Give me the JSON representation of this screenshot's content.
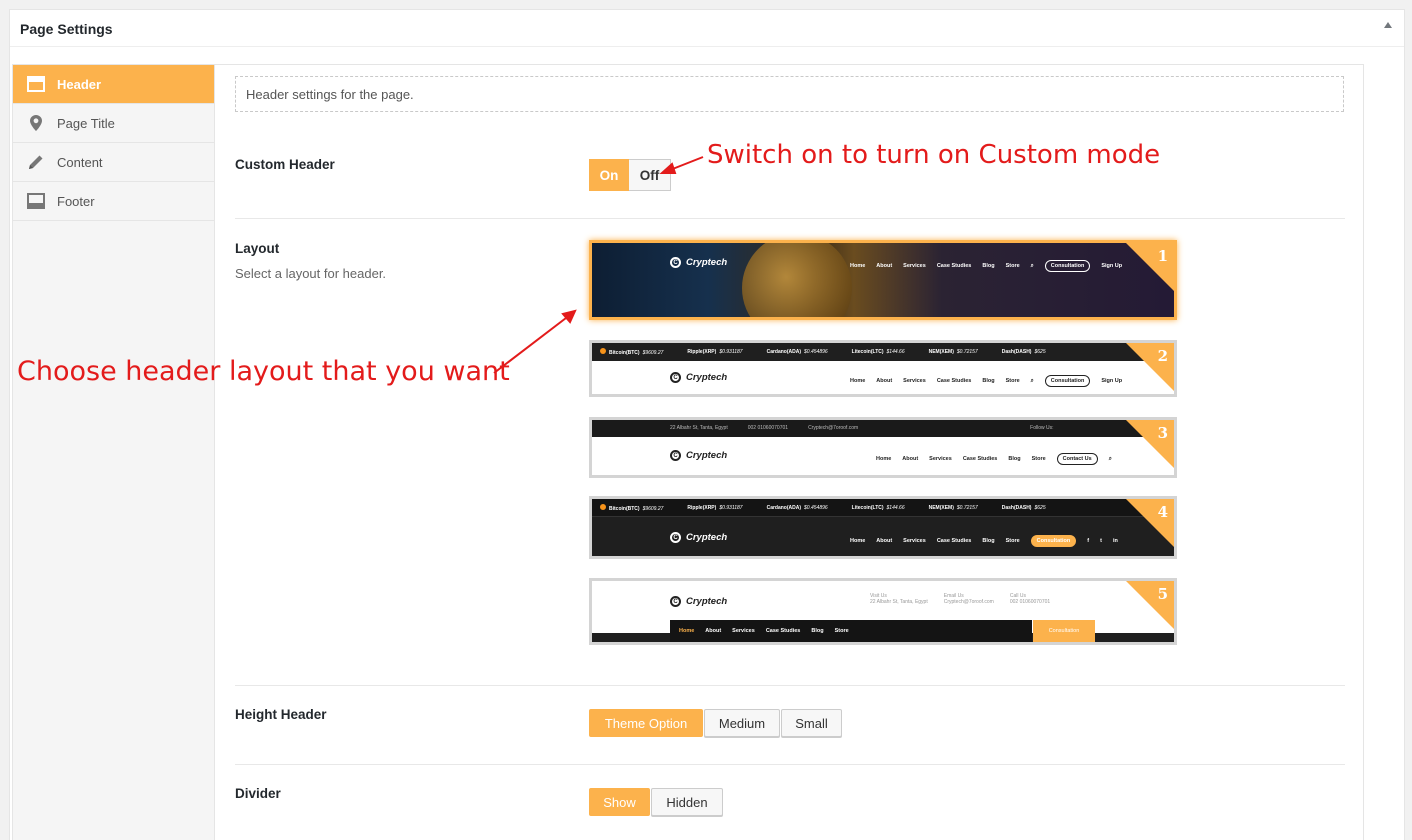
{
  "metabox": {
    "title": "Page Settings"
  },
  "sidebar": {
    "items": [
      {
        "label": "Header",
        "icon": "header-layout-icon",
        "active": true
      },
      {
        "label": "Page Title",
        "icon": "location-pin-icon",
        "active": false
      },
      {
        "label": "Content",
        "icon": "pencil-icon",
        "active": false
      },
      {
        "label": "Footer",
        "icon": "footer-layout-icon",
        "active": false
      }
    ]
  },
  "main": {
    "description": "Header settings for the page.",
    "custom_header": {
      "label": "Custom Header",
      "on": "On",
      "off": "Off",
      "value": "On"
    },
    "layout": {
      "label": "Layout",
      "sub": "Select a layout for header.",
      "selected": 1,
      "options": [
        {
          "number": "1",
          "logo": "Cryptech",
          "nav": [
            "Home",
            "About",
            "Services",
            "Case Studies",
            "Blog",
            "Store"
          ],
          "cta": "Consultation",
          "extra": "Sign Up"
        },
        {
          "number": "2",
          "logo": "Cryptech",
          "nav": [
            "Home",
            "About",
            "Services",
            "Case Studies",
            "Blog",
            "Store"
          ],
          "cta": "Consultation",
          "extra": "Sign Up",
          "ticker": [
            [
              "Bitcoin(BTC)",
              "$9609.27"
            ],
            [
              "Ripple(XRP)",
              "$0.931187"
            ],
            [
              "Cardano(ADA)",
              "$0.454896"
            ],
            [
              "Litecoin(LTC)",
              "$144.66"
            ],
            [
              "NEM(XEM)",
              "$0.72157"
            ],
            [
              "Dash(DASH)",
              "$625"
            ]
          ]
        },
        {
          "number": "3",
          "logo": "Cryptech",
          "nav": [
            "Home",
            "About",
            "Services",
            "Case Studies",
            "Blog",
            "Store"
          ],
          "cta": "Contact Us",
          "topbar": [
            "22 Albahr St, Tanta, Egypt",
            "002 01060070701",
            "Cryptech@7oroof.com"
          ],
          "follow": "Follow Us:"
        },
        {
          "number": "4",
          "logo": "Cryptech",
          "nav": [
            "Home",
            "About",
            "Services",
            "Case Studies",
            "Blog",
            "Store"
          ],
          "cta": "Consultation",
          "ticker": [
            [
              "Bitcoin(BTC)",
              "$9609.27"
            ],
            [
              "Ripple(XRP)",
              "$0.931187"
            ],
            [
              "Cardano(ADA)",
              "$0.454896"
            ],
            [
              "Litecoin(LTC)",
              "$144.66"
            ],
            [
              "NEM(XEM)",
              "$0.72157"
            ],
            [
              "Dash(DASH)",
              "$625"
            ]
          ]
        },
        {
          "number": "5",
          "logo": "Cryptech",
          "nav": [
            "Home",
            "About",
            "Services",
            "Case Studies",
            "Blog",
            "Store"
          ],
          "cta": "Consultation",
          "info": [
            [
              "Visit Us",
              "22 Albahr St, Tanta, Egypt"
            ],
            [
              "Email Us",
              "Cryptech@7oroof.com"
            ],
            [
              "Call Us",
              "002 01060070701"
            ]
          ]
        }
      ]
    },
    "height_header": {
      "label": "Height Header",
      "options": [
        "Theme Option",
        "Medium",
        "Small"
      ],
      "value": "Theme Option"
    },
    "divider": {
      "label": "Divider",
      "options": [
        "Show",
        "Hidden"
      ],
      "value": "Show"
    }
  },
  "annotations": {
    "switch_note": "Switch on to turn on Custom mode",
    "layout_note": "Choose header layout that you want"
  },
  "colors": {
    "accent": "#fcb24c",
    "annotation": "#e31b1b"
  }
}
